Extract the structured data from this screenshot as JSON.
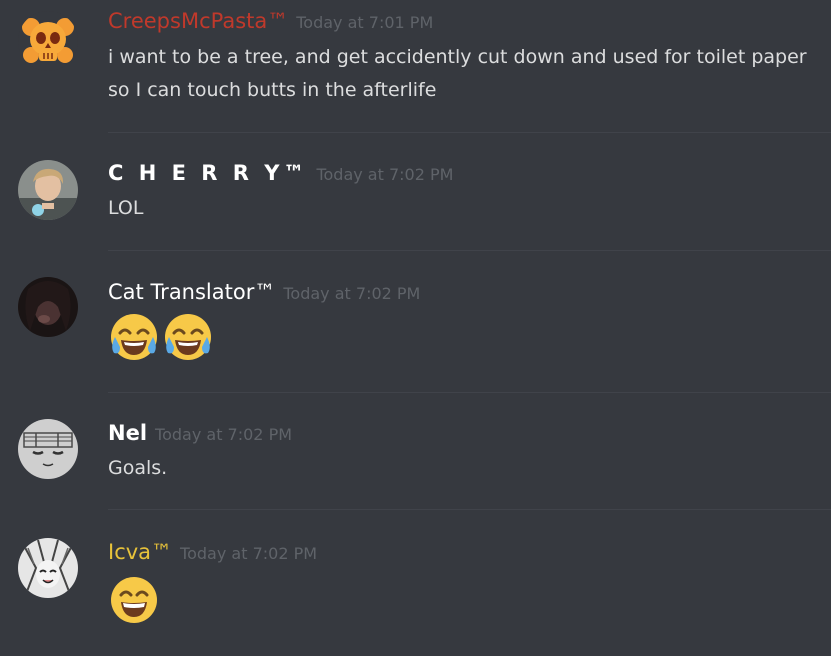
{
  "messages": [
    {
      "username": "CreepsMcPasta™",
      "timestamp": "Today at 7:01 PM",
      "lines": [
        "i want to be a tree, and get accidently cut down and used for toilet paper",
        "so I can touch butts in the afterlife"
      ],
      "name_color": "#c0392b",
      "avatar": "orange-skull-avatar"
    },
    {
      "username": "C H E R R Y™",
      "timestamp": "Today at 7:02 PM",
      "lines": [
        "LOL"
      ],
      "name_color": "#ffffff",
      "avatar": "boy-photo-avatar"
    },
    {
      "username": "Cat Translator™",
      "timestamp": "Today at 7:02 PM",
      "emojis": [
        "face-with-tears-of-joy",
        "face-with-tears-of-joy"
      ],
      "name_color": "#ffffff",
      "avatar": "dark-photo-avatar"
    },
    {
      "username": "Nel",
      "timestamp": "Today at 7:02 PM",
      "lines": [
        "Goals."
      ],
      "name_color": "#ffffff",
      "avatar": "sketch-face-avatar"
    },
    {
      "username": "Icva™",
      "timestamp": "Today at 7:02 PM",
      "emojis": [
        "grinning-face-with-smiling-eyes"
      ],
      "name_color": "#e8c33a",
      "avatar": "manga-avatar"
    }
  ],
  "colors": {
    "background": "#36393f",
    "divider": "#40434a",
    "timestamp": "#5f6369",
    "message_text": "#dcddde"
  }
}
